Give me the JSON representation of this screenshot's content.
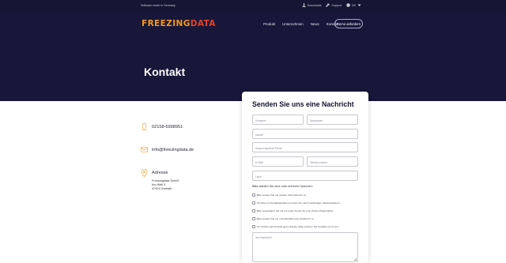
{
  "topbar": {
    "tagline": "Software made in Germany",
    "links": [
      "Downloads",
      "Support"
    ],
    "language": "DE"
  },
  "header": {
    "logo_part1": "FREEZING",
    "logo_part2": "DATA",
    "nav": [
      "Produkt",
      "Unternehmen",
      "News",
      "Kontakt"
    ],
    "demo_button": "Demo anfordern"
  },
  "page": {
    "title": "Kontakt"
  },
  "contact": {
    "phone": "02158-6998951",
    "email": "info@freezingdata.de",
    "address_heading": "Adresse",
    "address_lines": [
      "Freezingdata GmbH",
      "Am Wall 3",
      "47929 Grefrath"
    ]
  },
  "form": {
    "title": "Senden Sie uns eine Nachricht",
    "firstname_placeholder": "Vorname*",
    "lastname_placeholder": "Nachname*",
    "company_placeholder": "Institut*",
    "contact_placeholder": "Ansprechpartner*Firma*",
    "email_placeholder": "E-Mail*",
    "phone_placeholder": "Telefonnummer",
    "country_placeholder": "Land*",
    "options_hint": "Bitte wählen Sie eine oder mehrere Optionen:",
    "options": [
      "Bitte senden Sie mir weitere Informationen zu.",
      "Ich bitte um Kontaktaufnahme mit dem für mich zuständigen Vertriebspartner.",
      "Bitte vereinbaren Sie mit mir einen Termin für eine Online-Präsentation.",
      "Bitte senden Sie mir unverbindlich eine Testlizenz zu.",
      "Ich möchte das Produkt gerne kaufen (bitte nehmen Sie Kontakt mit mir auf."
    ],
    "message_placeholder": "Ihre Nachricht*"
  }
}
